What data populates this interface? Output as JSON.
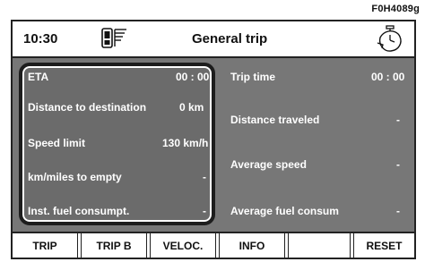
{
  "figure_code": "F0H4089g",
  "topbar": {
    "time": "10:30",
    "title": "General trip",
    "phone_icon": "phone-signal-icon",
    "trip_icon": "stopwatch-icon"
  },
  "left_panel": {
    "eta_label": "ETA",
    "eta_value": "00 : 00",
    "distance_dest_label": "Distance to destination",
    "distance_dest_value": "0 km",
    "speed_limit_label": "Speed limit",
    "speed_limit_value": "130 km/h",
    "km_to_empty_label": "km/miles to empty",
    "km_to_empty_value": "-",
    "inst_fuel_label": "Inst. fuel consumpt.",
    "inst_fuel_value": "-"
  },
  "right_panel": {
    "trip_time_label": "Trip time",
    "trip_time_value": "00 : 00",
    "distance_traveled_label": "Distance traveled",
    "distance_traveled_value": "-",
    "avg_speed_label": "Average speed",
    "avg_speed_value": "-",
    "avg_fuel_label": "Average fuel consum",
    "avg_fuel_value": "-"
  },
  "softkeys": {
    "trip": "TRIP",
    "trip_b": "TRIP B",
    "veloc": "VELOC.",
    "info": "INFO",
    "empty": "",
    "reset": "RESET"
  },
  "colors": {
    "panel_grey": "#777777",
    "frame": "#1d1d1d",
    "text_light": "#ffffff"
  }
}
